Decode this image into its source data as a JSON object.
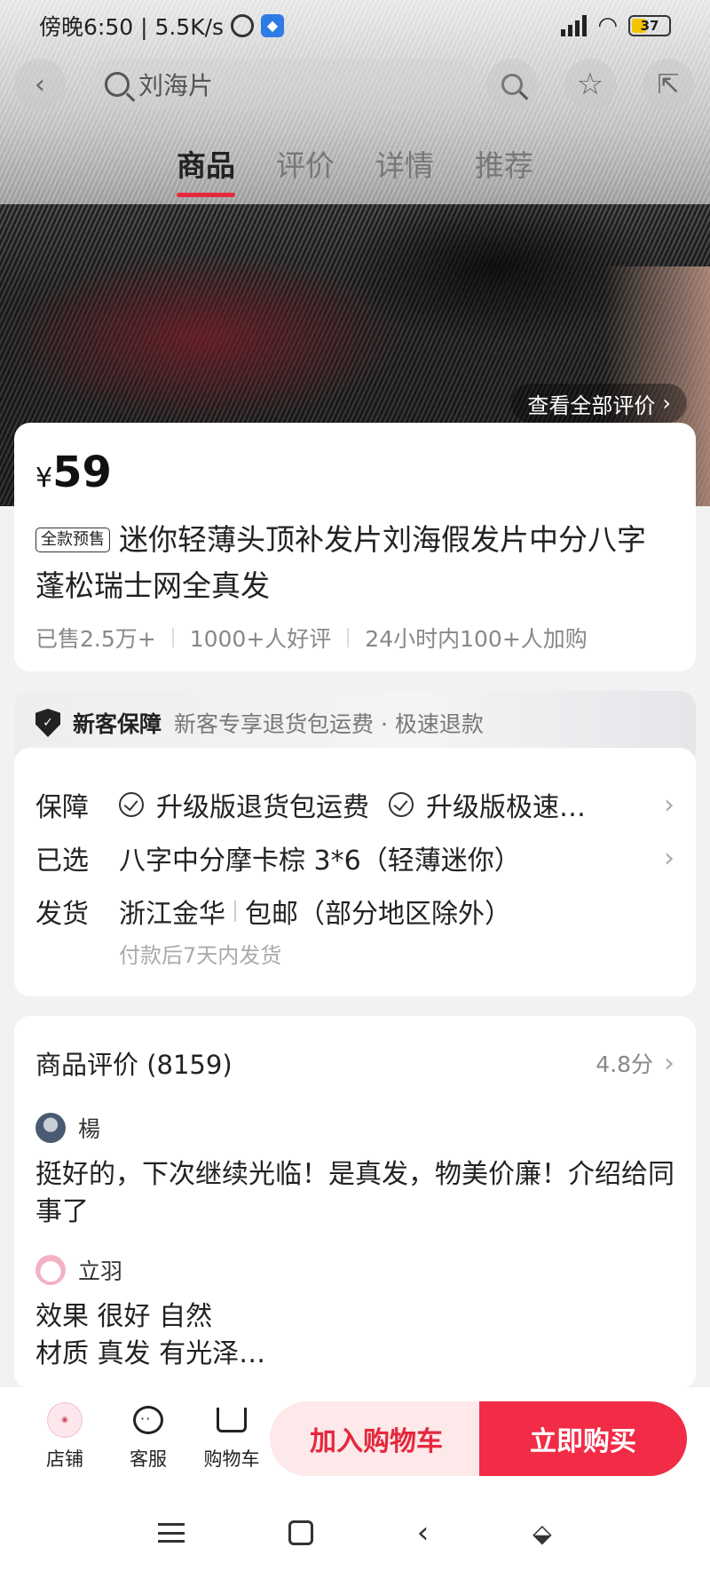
{
  "status": {
    "time_text": "傍晚6:50 | 5.5K/s",
    "battery": "37"
  },
  "search": {
    "query": "刘海片"
  },
  "tabs": [
    "商品",
    "评价",
    "详情",
    "推荐"
  ],
  "hero": {
    "all_reviews_label": "查看全部评价"
  },
  "product": {
    "currency": "¥",
    "price": "59",
    "badge": "全款预售",
    "title": "迷你轻薄头顶补发片刘海假发片中分八字蓬松瑞士网全真发",
    "sold": "已售2.5万+",
    "good_reviews": "1000+人好评",
    "added_24h": "24小时内100+人加购"
  },
  "guarantee": {
    "title": "新客保障",
    "desc": "新客专享退货包运费 · 极速退款"
  },
  "info": {
    "guarantee_label": "保障",
    "guarantee_item1": "升级版退货包运费",
    "guarantee_item2": "升级版极速…",
    "selected_label": "已选",
    "selected_value": "八字中分摩卡棕 3*6（轻薄迷你）",
    "shipping_label": "发货",
    "shipping_origin": "浙江金华",
    "shipping_fee": "包邮（部分地区除外）",
    "shipping_note": "付款后7天内发货"
  },
  "reviews": {
    "title": "商品评价 (8159)",
    "score": "4.8分",
    "items": [
      {
        "user": "楊",
        "text": "挺好的，下次继续光临！是真发，物美价廉！介绍给同事了"
      },
      {
        "user": "立羽",
        "text_line1": "效果 很好 自然",
        "text_line2": "材质 真发 有光泽…"
      }
    ]
  },
  "bottom_bar": {
    "store_label": "店铺",
    "service_label": "客服",
    "cart_label": "购物车",
    "add_cart_label": "加入购物车",
    "buy_now_label": "立即购买"
  },
  "colors": {
    "accent": "#e5283d",
    "buy_button": "#f22b46",
    "cart_button_bg": "#fde8ea"
  }
}
